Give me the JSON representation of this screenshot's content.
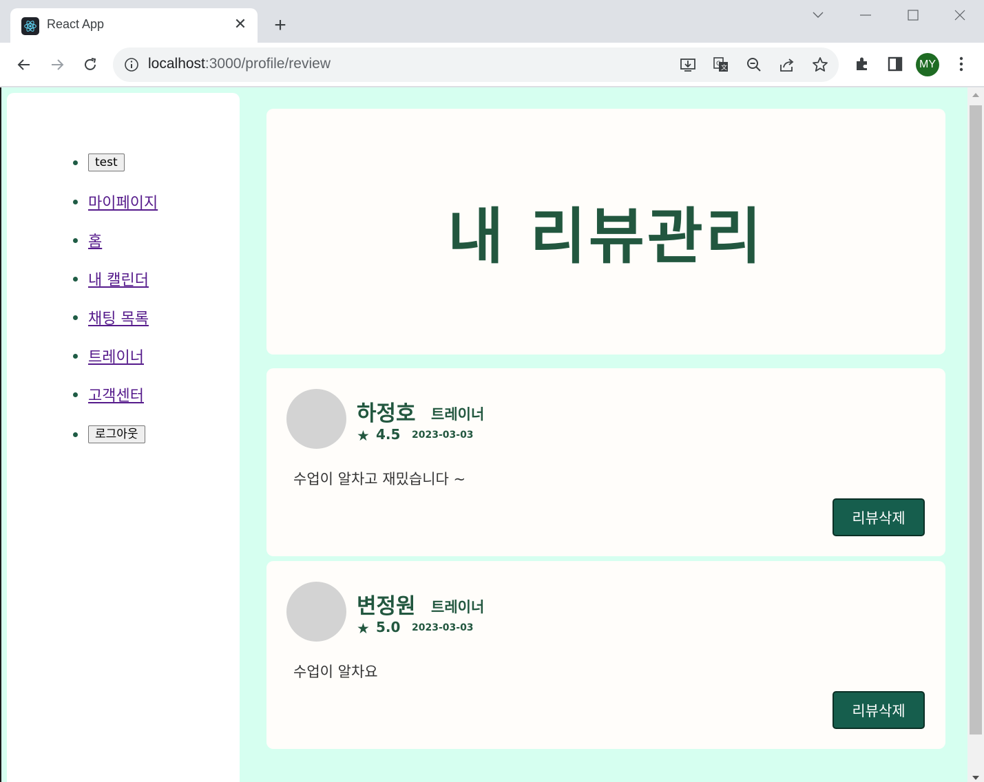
{
  "browser": {
    "tab_title": "React App",
    "tab_close": "✕",
    "new_tab": "+",
    "url_host": "localhost",
    "url_rest": ":3000/profile/review",
    "profile_initials": "MY"
  },
  "sidebar": {
    "items": [
      {
        "type": "button",
        "label": "test"
      },
      {
        "type": "link",
        "label": "마이페이지"
      },
      {
        "type": "link",
        "label": "홈"
      },
      {
        "type": "link",
        "label": "내 캘린더"
      },
      {
        "type": "link",
        "label": "채팅 목록"
      },
      {
        "type": "link",
        "label": "트레이너"
      },
      {
        "type": "link",
        "label": "고객센터"
      },
      {
        "type": "button",
        "label": "로그아웃"
      }
    ]
  },
  "page": {
    "title": "내 리뷰관리"
  },
  "reviews": [
    {
      "name": "하정호",
      "role": "트레이너",
      "star": "★",
      "rating": "4.5",
      "date": "2023-03-03",
      "content": "수업이 알차고 재밌습니다 ~",
      "delete_label": "리뷰삭제"
    },
    {
      "name": "변정원",
      "role": "트레이너",
      "star": "★",
      "rating": "5.0",
      "date": "2023-03-03",
      "content": "수업이 알차요",
      "delete_label": "리뷰삭제"
    }
  ],
  "colors": {
    "page_background": "#d6fff0",
    "card_background": "#fffdfa",
    "accent_text": "#22573f",
    "delete_button": "#165e4d"
  }
}
